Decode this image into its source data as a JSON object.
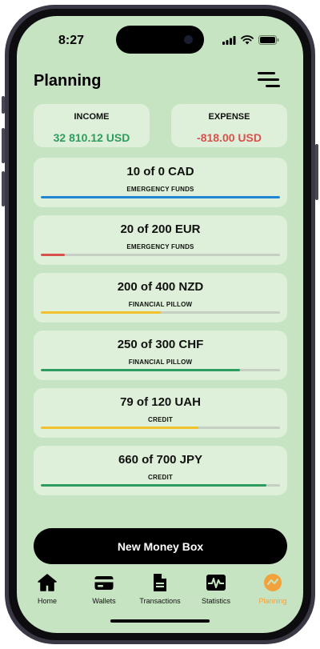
{
  "status_bar": {
    "time": "8:27"
  },
  "header": {
    "title": "Planning"
  },
  "summary": {
    "income": {
      "label": "INCOME",
      "value": "32 810.12 USD",
      "color": "#2e9c5f"
    },
    "expense": {
      "label": "EXPENSE",
      "value": "-818.00 USD",
      "color": "#d9504d"
    }
  },
  "money_boxes": [
    {
      "amount": "10 of 0 CAD",
      "category": "EMERGENCY FUNDS",
      "progress": 1.0,
      "color": "#1f86d6"
    },
    {
      "amount": "20 of 200 EUR",
      "category": "EMERGENCY FUNDS",
      "progress": 0.1,
      "color": "#d9504d"
    },
    {
      "amount": "200 of 400 NZD",
      "category": "FINANCIAL PILLOW",
      "progress": 0.5,
      "color": "#f2c12e"
    },
    {
      "amount": "250 of 300 CHF",
      "category": "FINANCIAL PILLOW",
      "progress": 0.833,
      "color": "#2e9c5f"
    },
    {
      "amount": "79 of 120 UAH",
      "category": "CREDIT",
      "progress": 0.658,
      "color": "#f2c12e"
    },
    {
      "amount": "660 of 700 JPY",
      "category": "CREDIT",
      "progress": 0.943,
      "color": "#2e9c5f"
    }
  ],
  "cta": {
    "label": "New Money Box"
  },
  "tabs": [
    {
      "label": "Home",
      "icon": "home-icon"
    },
    {
      "label": "Wallets",
      "icon": "wallet-icon"
    },
    {
      "label": "Transactions",
      "icon": "document-icon"
    },
    {
      "label": "Statistics",
      "icon": "chart-icon"
    },
    {
      "label": "Planning",
      "icon": "planning-icon",
      "active": true
    }
  ],
  "colors": {
    "accent": "#f2a23c",
    "background": "#c7e4c2",
    "card": "#def0d9"
  }
}
